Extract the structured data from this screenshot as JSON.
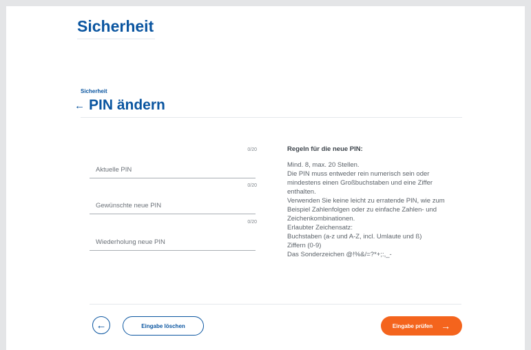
{
  "header": {
    "title": "Sicherheit"
  },
  "breadcrumb": "Sicherheit",
  "page_title": "PIN ändern",
  "icons": {
    "back": "arrow-left-icon",
    "next": "arrow-right-icon"
  },
  "form": {
    "fields": [
      {
        "label": "Aktuelle PIN",
        "counter": "0/20",
        "value": ""
      },
      {
        "label": "Gewünschte neue PIN",
        "counter": "0/20",
        "value": ""
      },
      {
        "label": "Wiederholung neue PIN",
        "counter": "0/20",
        "value": ""
      }
    ]
  },
  "rules": {
    "title": "Regeln für die neue PIN:",
    "lines": [
      "Mind. 8, max. 20 Stellen.",
      "Die PIN muss entweder rein numerisch sein oder",
      "mindestens einen Großbuchstaben und eine Ziffer",
      "enthalten.",
      "Verwenden Sie keine leicht zu erratende PIN, wie zum",
      "Beispiel Zahlenfolgen oder zu einfache Zahlen- und",
      "Zeichenkombinationen.",
      "Erlaubter Zeichensatz:",
      "Buchstaben (a-z und A-Z, incl. Umlaute und ß)",
      "Ziffern (0-9)",
      "Das Sonderzeichen @!%&/=?*+;:,_-"
    ]
  },
  "actions": {
    "clear_label": "Eingabe löschen",
    "submit_label": "Eingabe prüfen"
  },
  "colors": {
    "primary": "#0a55a0",
    "accent": "#f4641d",
    "background": "#e4e5e7"
  }
}
